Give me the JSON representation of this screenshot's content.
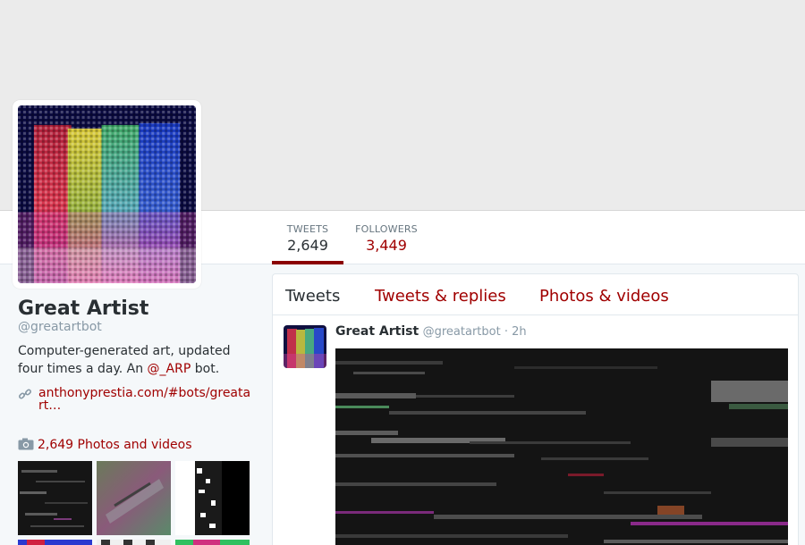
{
  "profile": {
    "name": "Great Artist",
    "handle": "@greatartbot",
    "bio_prefix": "Computer-generated art, updated four times a day. An ",
    "bio_mention": "@_ARP",
    "bio_suffix": " bot.",
    "url": "anthonyprestia.com/#bots/greatart…",
    "photos_videos": "2,649 Photos and videos"
  },
  "stats": [
    {
      "label": "TWEETS",
      "value": "2,649"
    },
    {
      "label": "FOLLOWERS",
      "value": "3,449"
    }
  ],
  "timeline": {
    "tabs": [
      "Tweets",
      "Tweets & replies",
      "Photos & videos"
    ],
    "active_tab": "Tweets"
  },
  "tweet": {
    "name": "Great Artist",
    "handle": "@greatartbot",
    "separator": " · ",
    "time": "2h"
  },
  "colors": {
    "accent": "#a00000",
    "banner": "#ebebeb",
    "text": "#292f33",
    "muted": "#8899a6"
  },
  "icons": {
    "link": "link-icon",
    "camera": "camera-icon"
  }
}
